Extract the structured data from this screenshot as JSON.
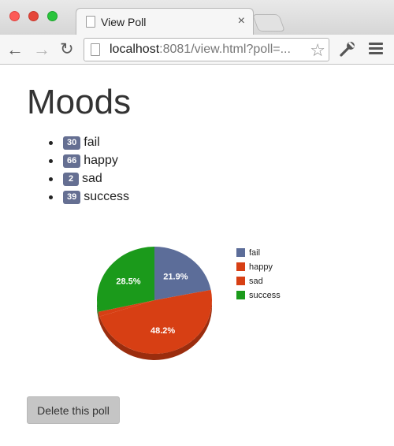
{
  "browser": {
    "tab_title": "View Poll",
    "tab_close": "×",
    "url_host": "localhost",
    "url_rest": ":8081/view.html?poll=...",
    "back_glyph": "←",
    "forward_glyph": "→",
    "reload_glyph": "↻",
    "star_glyph": "☆",
    "icons": [
      "page-icon",
      "back-icon",
      "forward-icon",
      "reload-icon",
      "star-icon",
      "wrench-icon",
      "menu-icon",
      "close-icon"
    ]
  },
  "page": {
    "title": "Moods",
    "delete_button_label": "Delete this poll"
  },
  "moods": [
    {
      "count": "30",
      "label": "fail"
    },
    {
      "count": "66",
      "label": "happy"
    },
    {
      "count": "2",
      "label": "sad"
    },
    {
      "count": "39",
      "label": "success"
    }
  ],
  "chart_data": {
    "type": "pie",
    "slices": [
      {
        "label": "fail",
        "value": 30,
        "percent_label": "21.9%",
        "color": "#5c6d99"
      },
      {
        "label": "happy",
        "value": 66,
        "percent_label": "48.2%",
        "color": "#d73f14"
      },
      {
        "label": "sad",
        "value": 2,
        "percent_label": "",
        "color": "#d73f14"
      },
      {
        "label": "success",
        "value": 39,
        "percent_label": "28.5%",
        "color": "#1b9a1b"
      }
    ],
    "legend": [
      "fail",
      "happy",
      "sad",
      "success"
    ],
    "legend_position": "right"
  },
  "colors": {
    "badge": "#656f92",
    "fail": "#5c6d99",
    "happy": "#d73f14",
    "sad": "#d73f14",
    "success": "#1b9a1b"
  }
}
